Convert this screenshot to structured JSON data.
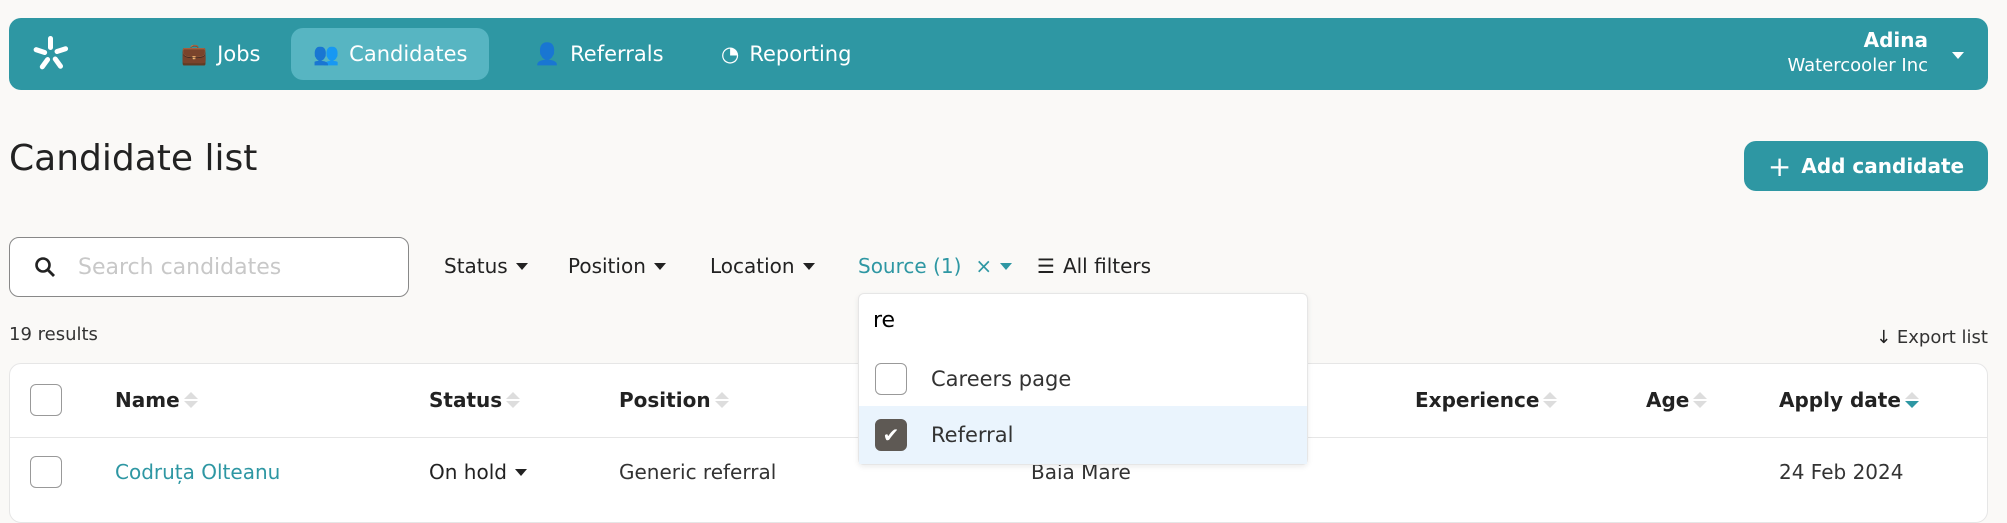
{
  "nav": {
    "items": [
      {
        "label": "Jobs",
        "icon": "briefcase-icon"
      },
      {
        "label": "Candidates",
        "icon": "users-icon",
        "active": true
      },
      {
        "label": "Referrals",
        "icon": "user-pair-icon"
      },
      {
        "label": "Reporting",
        "icon": "pie-chart-icon"
      }
    ],
    "user": {
      "name": "Adina",
      "company": "Watercooler Inc"
    }
  },
  "page": {
    "title": "Candidate list",
    "add_label": "Add candidate"
  },
  "search": {
    "placeholder": "Search candidates",
    "value": ""
  },
  "filters": {
    "status": "Status",
    "position": "Position",
    "location": "Location",
    "source": "Source (1)",
    "clear": "×",
    "all": "All filters"
  },
  "source_dropdown": {
    "query": "re",
    "options": [
      {
        "label": "Careers page",
        "checked": false
      },
      {
        "label": "Referral",
        "checked": true
      }
    ]
  },
  "results": "19 results",
  "export_label": "Export list",
  "table": {
    "headers": [
      "Name",
      "Status",
      "Position",
      "Experience",
      "Age",
      "Apply date"
    ],
    "rows": [
      {
        "name": "Codruța Olteanu",
        "status": "On hold",
        "position": "Generic referral",
        "location": "Baia Mare",
        "apply_date": "24 Feb 2024"
      }
    ],
    "sort": {
      "column": "Apply date",
      "direction": "desc"
    }
  },
  "colors": {
    "brand": "#2e97a3",
    "active_nav": "#57b5c2",
    "selected_option": "#eaf4fd"
  }
}
